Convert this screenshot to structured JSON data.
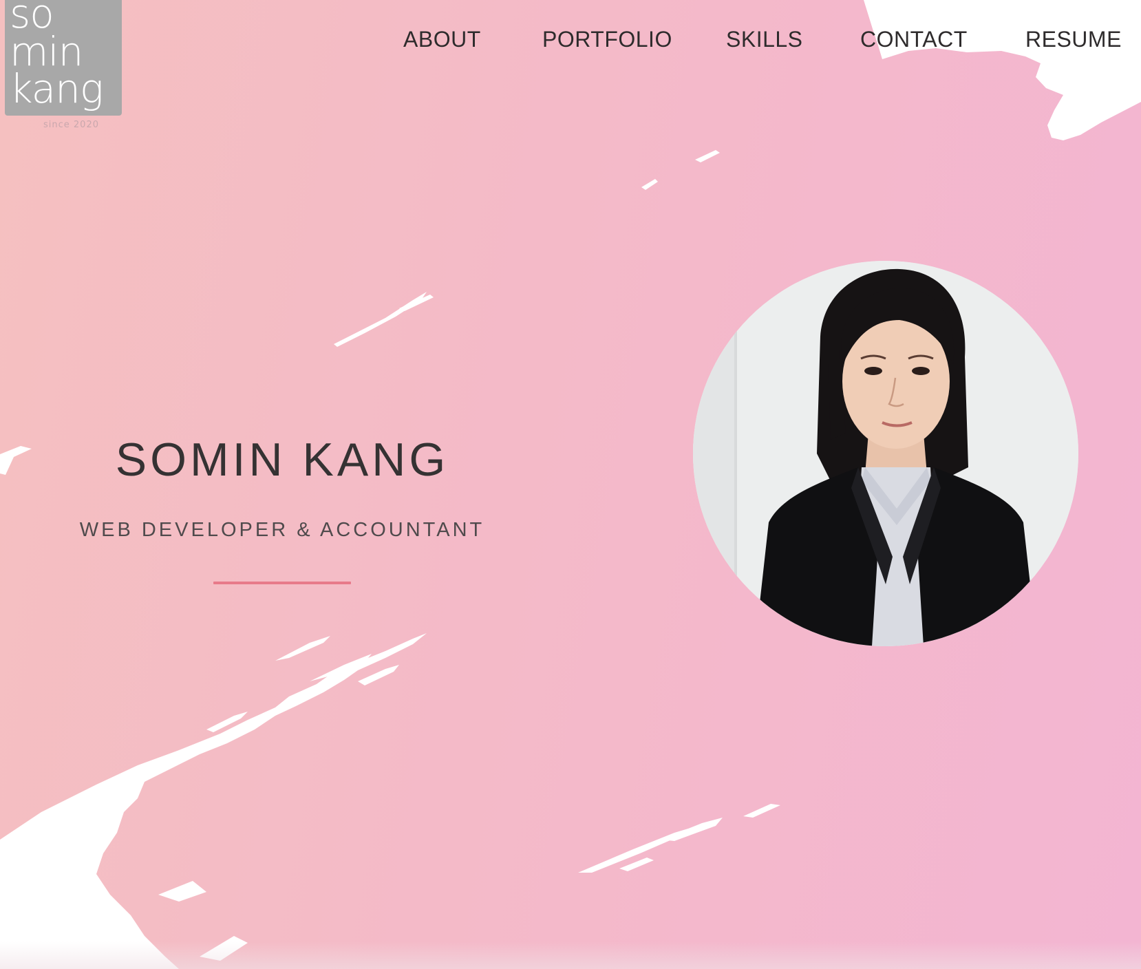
{
  "logo": {
    "line1": "so",
    "line2": "min",
    "line3": "kang",
    "tagline": "since 2020"
  },
  "nav": {
    "items": [
      {
        "label": "ABOUT"
      },
      {
        "label": "PORTFOLIO"
      },
      {
        "label": "SKILLS"
      },
      {
        "label": "CONTACT"
      },
      {
        "label": "RESUME"
      }
    ]
  },
  "hero": {
    "name": "SOMIN KANG",
    "title": "WEB DEVELOPER & ACCOUNTANT",
    "accent_color": "#e87a8a",
    "background_colors": [
      "#f5c0c0",
      "#f3b5d2"
    ]
  },
  "avatar": {
    "icon": "profile-photo"
  }
}
